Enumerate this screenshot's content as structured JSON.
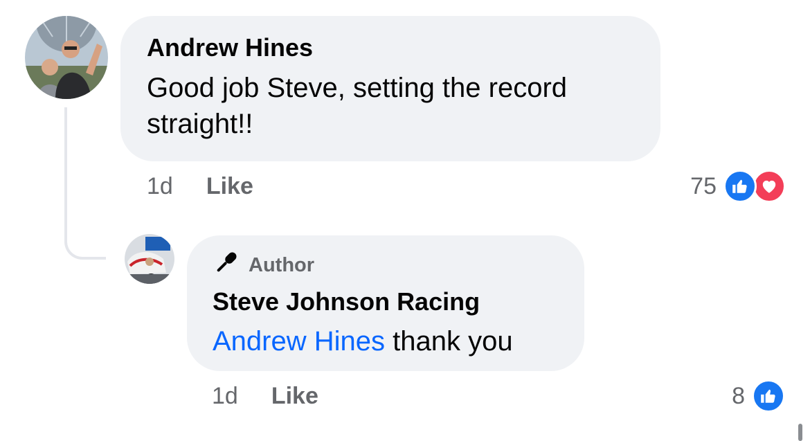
{
  "comment": {
    "author": "Andrew Hines",
    "text": "Good job Steve, setting the record straight!!",
    "time": "1d",
    "like_label": "Like",
    "reaction_count": "75",
    "reactions": [
      "like-icon",
      "love-icon"
    ]
  },
  "reply": {
    "badge_label": "Author",
    "author": "Steve Johnson Racing",
    "mention": "Andrew Hines",
    "text": " thank you",
    "time": "1d",
    "like_label": "Like",
    "reaction_count": "8",
    "reactions": [
      "like-icon"
    ]
  },
  "colors": {
    "bubble_bg": "#f0f2f5",
    "mention": "#0866ff",
    "secondary_text": "#65676b",
    "like_blue": "#1877f2",
    "love_red": "#f33e58"
  }
}
